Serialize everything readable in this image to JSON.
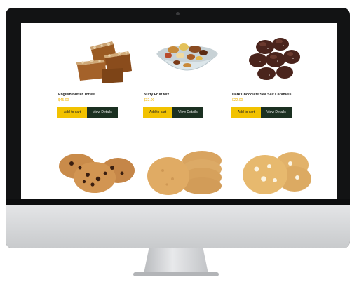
{
  "products": [
    {
      "name": "English Butter Toffee",
      "price": "$45.00",
      "add_label": "Add to cart",
      "view_label": "View Details",
      "icon": "toffee-image"
    },
    {
      "name": "Nutty Fruit Mix",
      "price": "$32.00",
      "add_label": "Add to cart",
      "view_label": "View Details",
      "icon": "nut-mix-image"
    },
    {
      "name": "Dark Chocolate Sea Salt Caramels",
      "price": "$22.00",
      "add_label": "Add to cart",
      "view_label": "View Details",
      "icon": "caramels-image"
    }
  ],
  "cookies": [
    {
      "icon": "chocolate-chip-cookies-image"
    },
    {
      "icon": "peanut-butter-cookies-image"
    },
    {
      "icon": "white-chocolate-cookies-image"
    }
  ],
  "colors": {
    "cart_button": "#f2c200",
    "view_button": "#1b3021",
    "price": "#f2b705",
    "bezel": "#121314"
  }
}
